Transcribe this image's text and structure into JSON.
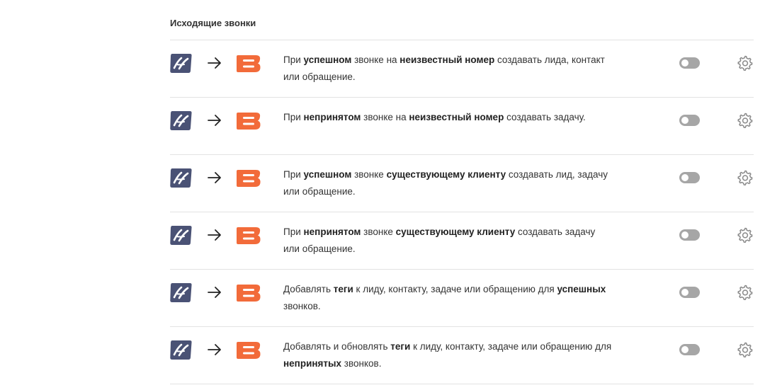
{
  "section": {
    "title": "Исходящие звонки"
  },
  "icons": {
    "source": "telephony-logo-icon",
    "arrow": "arrow-right-icon",
    "target": "crm-b-logo-icon",
    "settings": "gear-icon"
  },
  "colors": {
    "source_logo": "#4a5275",
    "target_logo": "#f26b3a",
    "toggle_off": "#a6a6a6",
    "divider": "#e2e2e2"
  },
  "rules": [
    {
      "line1": [
        [
          "При ",
          false
        ],
        [
          "успешном",
          true
        ],
        [
          " звонке на ",
          false
        ],
        [
          "неизвестный номер",
          true
        ],
        [
          " создавать лида, контакт",
          false
        ]
      ],
      "line2": [
        [
          "или обращение.",
          false
        ]
      ],
      "enabled": false
    },
    {
      "line1": [
        [
          "При ",
          false
        ],
        [
          "непринятом",
          true
        ],
        [
          " звонке на ",
          false
        ],
        [
          "неизвестный номер",
          true
        ],
        [
          " создавать задачу.",
          false
        ]
      ],
      "line2": [],
      "enabled": false
    },
    {
      "line1": [
        [
          "При ",
          false
        ],
        [
          "успешном",
          true
        ],
        [
          " звонке ",
          false
        ],
        [
          "существующему клиенту",
          true
        ],
        [
          " создавать лид, задачу",
          false
        ]
      ],
      "line2": [
        [
          "или обращение.",
          false
        ]
      ],
      "enabled": false
    },
    {
      "line1": [
        [
          "При ",
          false
        ],
        [
          "непринятом",
          true
        ],
        [
          " звонке ",
          false
        ],
        [
          "существующему клиенту",
          true
        ],
        [
          " создавать задачу",
          false
        ]
      ],
      "line2": [
        [
          "или обращение.",
          false
        ]
      ],
      "enabled": false
    },
    {
      "line1": [
        [
          "Добавлять ",
          false
        ],
        [
          "теги",
          true
        ],
        [
          " к лиду, контакту, задаче или обращению для ",
          false
        ],
        [
          "успешных",
          true
        ]
      ],
      "line2": [
        [
          "звонков.",
          false
        ]
      ],
      "enabled": false
    },
    {
      "line1": [
        [
          "Добавлять и обновлять ",
          false
        ],
        [
          "теги",
          true
        ],
        [
          " к лиду, контакту, задаче или обращению для",
          false
        ]
      ],
      "line2": [
        [
          "непринятых",
          true
        ],
        [
          " звонков.",
          false
        ]
      ],
      "enabled": false
    }
  ]
}
